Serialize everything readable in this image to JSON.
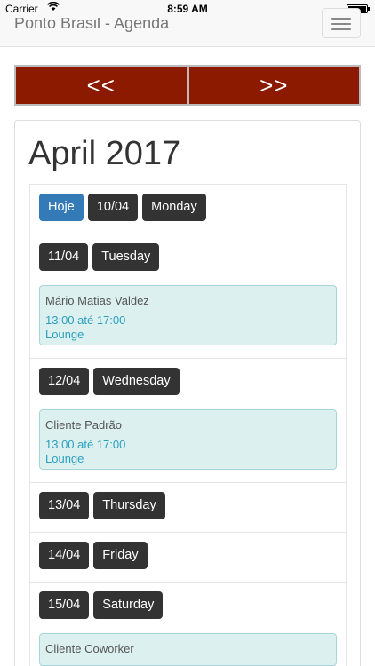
{
  "status_bar": {
    "carrier": "Carrier",
    "time": "8:59 AM"
  },
  "navbar": {
    "brand": "Ponto Brasil - Agenda"
  },
  "pager": {
    "prev": "<<",
    "next": ">>"
  },
  "calendar": {
    "month_title": "April 2017",
    "today_label": "Hoje",
    "days": [
      {
        "date": "10/04",
        "weekday": "Monday"
      },
      {
        "date": "11/04",
        "weekday": "Tuesday",
        "event": {
          "name": "Mário Matias Valdez",
          "time": "13:00 até 17:00",
          "place": "Lounge"
        }
      },
      {
        "date": "12/04",
        "weekday": "Wednesday",
        "event": {
          "name": "Cliente Padrão",
          "time": "13:00 até 17:00",
          "place": "Lounge"
        }
      },
      {
        "date": "13/04",
        "weekday": "Thursday"
      },
      {
        "date": "14/04",
        "weekday": "Friday"
      },
      {
        "date": "15/04",
        "weekday": "Saturday",
        "event": {
          "name": "Cliente Coworker",
          "time": "",
          "place": ""
        }
      }
    ]
  }
}
